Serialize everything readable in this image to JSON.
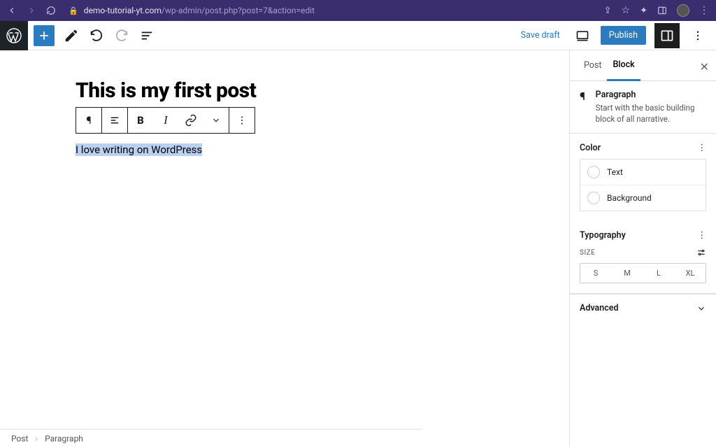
{
  "browser": {
    "url_host": "demo-tutorial-yt.com",
    "url_path": "/wp-admin/post.php?post=7&action=edit"
  },
  "topbar": {
    "save_draft": "Save draft",
    "publish": "Publish"
  },
  "editor": {
    "title": "This is my first post",
    "paragraph": "I love writing on WordPress"
  },
  "breadcrumb": {
    "root": "Post",
    "current": "Paragraph"
  },
  "sidebar": {
    "tabs": {
      "post": "Post",
      "block": "Block"
    },
    "block_info": {
      "name": "Paragraph",
      "desc": "Start with the basic building block of all narrative."
    },
    "color": {
      "heading": "Color",
      "text": "Text",
      "background": "Background"
    },
    "typography": {
      "heading": "Typography",
      "size_label": "SIZE",
      "sizes": [
        "S",
        "M",
        "L",
        "XL"
      ]
    },
    "advanced": "Advanced"
  }
}
